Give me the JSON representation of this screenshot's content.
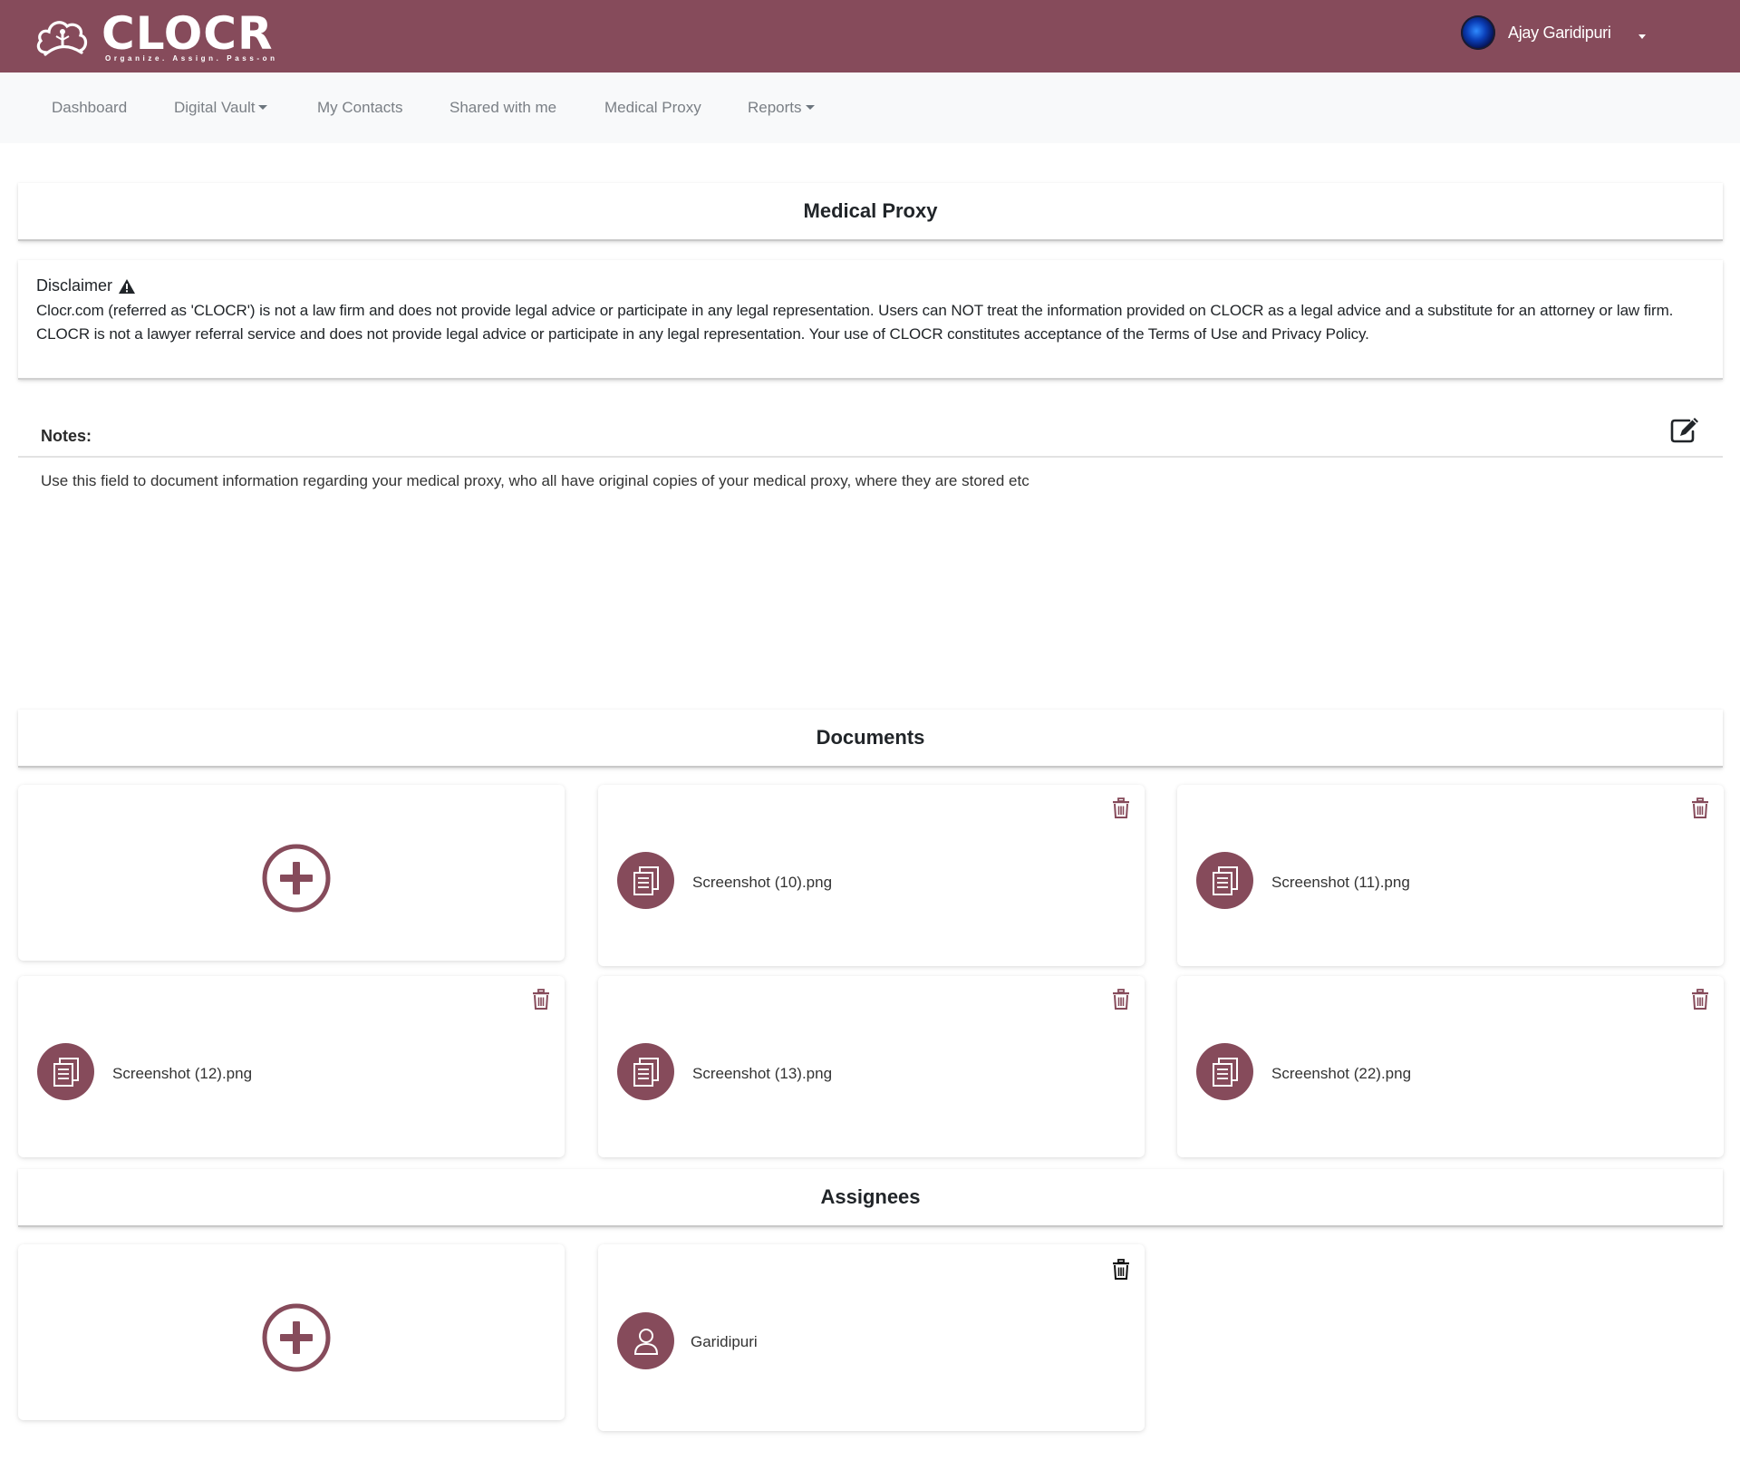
{
  "brand": {
    "name": "CLOCR",
    "tagline": "Organize. Assign. Pass-on",
    "color": "#864b5b"
  },
  "user": {
    "name": "Ajay Garidipuri"
  },
  "nav": {
    "items": [
      {
        "label": "Dashboard"
      },
      {
        "label": "Digital Vault"
      },
      {
        "label": "My Contacts"
      },
      {
        "label": "Shared with me"
      },
      {
        "label": "Medical Proxy"
      },
      {
        "label": "Reports"
      }
    ]
  },
  "page": {
    "title": "Medical Proxy"
  },
  "disclaimer": {
    "title": "Disclaimer",
    "text": "Clocr.com (referred as 'CLOCR') is not a law firm and does not provide legal advice or participate in any legal representation. Users can NOT treat the information provided on CLOCR as a legal advice and a substitute for an attorney or law firm. CLOCR is not a lawyer referral service and does not provide legal advice or participate in any legal representation. Your use of CLOCR constitutes acceptance of the Terms of Use and Privacy Policy."
  },
  "notes": {
    "label": "Notes:",
    "text": "Use this field to document information regarding your medical proxy, who all have original copies of your medical proxy, where they are stored etc"
  },
  "documents": {
    "title": "Documents",
    "files": [
      {
        "name": "Screenshot (10).png"
      },
      {
        "name": "Screenshot (11).png"
      },
      {
        "name": "Screenshot (12).png"
      },
      {
        "name": "Screenshot (13).png"
      },
      {
        "name": "Screenshot (22).png"
      }
    ]
  },
  "assignees": {
    "title": "Assignees",
    "people": [
      {
        "name": "Garidipuri"
      }
    ]
  }
}
